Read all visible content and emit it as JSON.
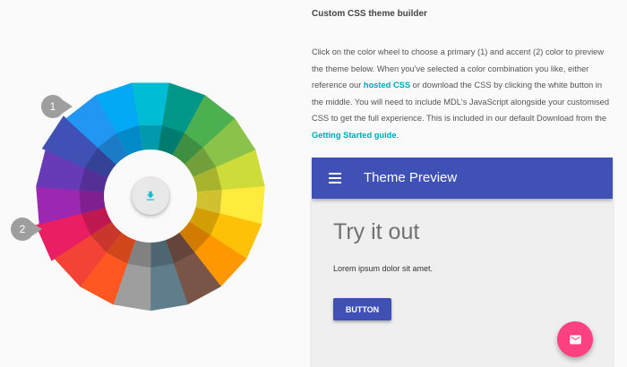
{
  "wheel": {
    "colors": [
      "#00BCD4",
      "#009688",
      "#4CAF50",
      "#8BC34A",
      "#CDDC39",
      "#FFEB3B",
      "#FFC107",
      "#FF9800",
      "#795548",
      "#607D8B",
      "#9E9E9E",
      "#FF5722",
      "#F44336",
      "#E91E63",
      "#9C27B0",
      "#673AB7",
      "#3F51B5",
      "#2196F3",
      "#03A9F4"
    ],
    "primary_index": 16,
    "accent_index": 13,
    "primary_badge": "1",
    "accent_badge": "2",
    "download_icon": "download-icon"
  },
  "info": {
    "title": "Custom CSS theme builder",
    "desc_part1": "Click on the color wheel to choose a primary (1) and accent (2) color to preview the theme below. When you've selected a color combination you like, either reference our ",
    "hosted_link": "hosted CSS",
    "desc_part2": " or download the CSS by clicking the white button in the middle. You will need to include MDL's JavaScript alongside your customised CSS to get the full experience. This is included in our default Download from the ",
    "guide_link": "Getting Started guide",
    "desc_part3": ".",
    "link_color": "#00A5B8"
  },
  "preview": {
    "appbar_title": "Theme Preview",
    "menu_icon": "menu-icon",
    "heading": "Try it out",
    "body_text": "Lorem ipsum dolor sit amet.",
    "button_label": "BUTTON",
    "fab_icon": "mail-icon",
    "primary_color": "#3F51B5",
    "accent_color": "#FF4081"
  }
}
